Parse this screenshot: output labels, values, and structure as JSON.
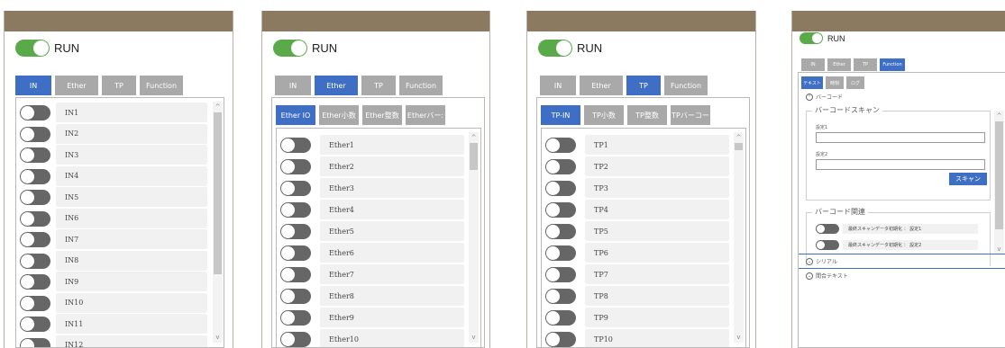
{
  "run_label": "RUN",
  "colors": {
    "header": "#8b7a5f",
    "accent": "#3e6fc4",
    "run_on": "#5aaa4a",
    "tab_inactive": "#a9a9a9",
    "toggle_off": "#666666"
  },
  "panel1": {
    "tabs": [
      "IN",
      "Ether",
      "TP",
      "Function"
    ],
    "active_tab": "IN",
    "items": [
      "IN1",
      "IN2",
      "IN3",
      "IN4",
      "IN5",
      "IN6",
      "IN7",
      "IN8",
      "IN9",
      "IN10",
      "IN11",
      "IN12"
    ]
  },
  "panel2": {
    "tabs": [
      "IN",
      "Ether",
      "TP",
      "Function"
    ],
    "active_tab": "Ether",
    "subtabs": [
      "Ether IO",
      "Ether小数",
      "Ether整数",
      "Etherバー:"
    ],
    "active_subtab": "Ether IO",
    "items": [
      "Ether1",
      "Ether2",
      "Ether3",
      "Ether4",
      "Ether5",
      "Ether6",
      "Ether7",
      "Ether8",
      "Ether9",
      "Ether10"
    ]
  },
  "panel3": {
    "tabs": [
      "IN",
      "Ether",
      "TP",
      "Function"
    ],
    "active_tab": "TP",
    "subtabs": [
      "TP-IN",
      "TP小数",
      "TP整数",
      "TPバーコー"
    ],
    "active_subtab": "TP-IN",
    "items": [
      "TP1",
      "TP2",
      "TP3",
      "TP4",
      "TP5",
      "TP6",
      "TP7",
      "TP8",
      "TP9",
      "TP10"
    ]
  },
  "panel4": {
    "tabs": [
      "IN",
      "Ether",
      "TP",
      "Function"
    ],
    "active_tab": "Function",
    "subtabs": [
      "テキスト",
      "時刻",
      "ログ"
    ],
    "active_subtab": "テキスト",
    "section_barcode": "バーコード",
    "barcode_scan_legend": "バーコードスキャン",
    "setting1_label": "設定1",
    "setting2_label": "設定2",
    "scan_button": "スキャン",
    "barcode_related_legend": "バーコード関連",
    "related_items": [
      "最終スキャンデータ初期化 ： 設定1",
      "最終スキャンデータ初期化 ： 設定2"
    ],
    "section_serial": "シリアル",
    "section_fixed_text": "間合テキスト"
  }
}
